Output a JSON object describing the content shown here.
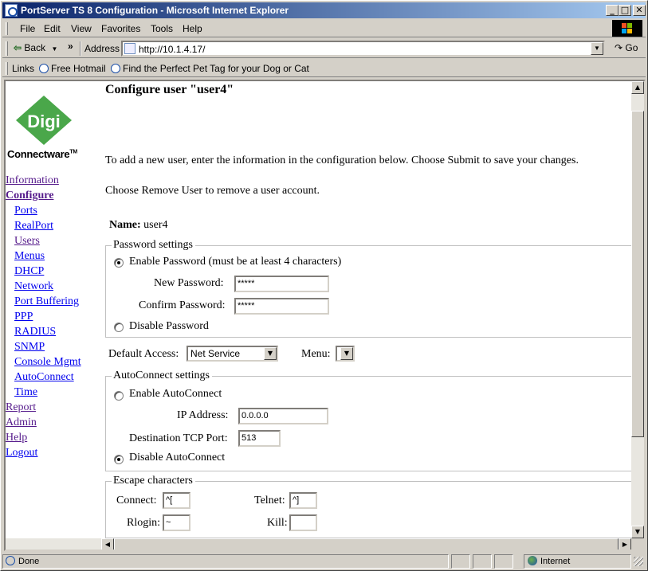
{
  "window": {
    "title": "PortServer TS 8 Configuration - Microsoft Internet Explorer",
    "minimize": "_",
    "maximize": "□",
    "close": "✕"
  },
  "menubar": {
    "items": [
      "File",
      "Edit",
      "View",
      "Favorites",
      "Tools",
      "Help"
    ]
  },
  "addressbar": {
    "back_label": "Back",
    "chevron": "»",
    "address_label": "Address",
    "url": "http://10.1.4.17/",
    "go_label": "Go"
  },
  "linksbar": {
    "label": "Links",
    "items": [
      "Free Hotmail",
      "Find the Perfect Pet Tag for your Dog or Cat"
    ]
  },
  "sidebar": {
    "logo_text": "Digi",
    "brand": "Connectware",
    "brand_tm": "TM",
    "nav": [
      {
        "label": "Information"
      },
      {
        "label": "Configure"
      },
      {
        "label": "Ports"
      },
      {
        "label": "RealPort"
      },
      {
        "label": "Users"
      },
      {
        "label": "Menus"
      },
      {
        "label": "DHCP"
      },
      {
        "label": "Network"
      },
      {
        "label": "Port Buffering"
      },
      {
        "label": "PPP"
      },
      {
        "label": "RADIUS"
      },
      {
        "label": "SNMP"
      },
      {
        "label": "Console Mgmt"
      },
      {
        "label": "AutoConnect"
      },
      {
        "label": "Time"
      },
      {
        "label": "Report"
      },
      {
        "label": "Admin"
      },
      {
        "label": "Help"
      },
      {
        "label": "Logout"
      }
    ]
  },
  "main": {
    "title": "Configure user \"user4\"",
    "intro": "To add a new user, enter the information in the configuration below. Choose Submit to save your changes.",
    "remove_note": "Choose Remove User to remove a user account.",
    "name_label": "Name:",
    "name_value": "user4",
    "password": {
      "legend": "Password settings",
      "enable_label": "Enable Password (must be at least 4 characters)",
      "new_label": "New Password:",
      "new_value": "*****",
      "confirm_label": "Confirm Password:",
      "confirm_value": "*****",
      "disable_label": "Disable Password",
      "enabled": true
    },
    "access": {
      "label": "Default Access:",
      "value": "Net Service",
      "menu_label": "Menu:",
      "menu_value": ""
    },
    "autoconnect": {
      "legend": "AutoConnect settings",
      "enable_label": "Enable AutoConnect",
      "ip_label": "IP Address:",
      "ip_value": "0.0.0.0",
      "port_label": "Destination TCP Port:",
      "port_value": "513",
      "disable_label": "Disable AutoConnect",
      "enabled": false
    },
    "escape": {
      "legend": "Escape characters",
      "connect_label": "Connect:",
      "connect_value": "^[",
      "telnet_label": "Telnet:",
      "telnet_value": "^]",
      "rlogin_label": "Rlogin:",
      "rlogin_value": "~",
      "kill_label": "Kill:",
      "kill_value": ""
    }
  },
  "statusbar": {
    "status": "Done",
    "zone": "Internet"
  },
  "colors": {
    "title_start": "#0a246a",
    "title_end": "#a6caf0",
    "digi_green": "#4aa74a",
    "link_visited": "#551a8b",
    "link": "#0000ee"
  }
}
